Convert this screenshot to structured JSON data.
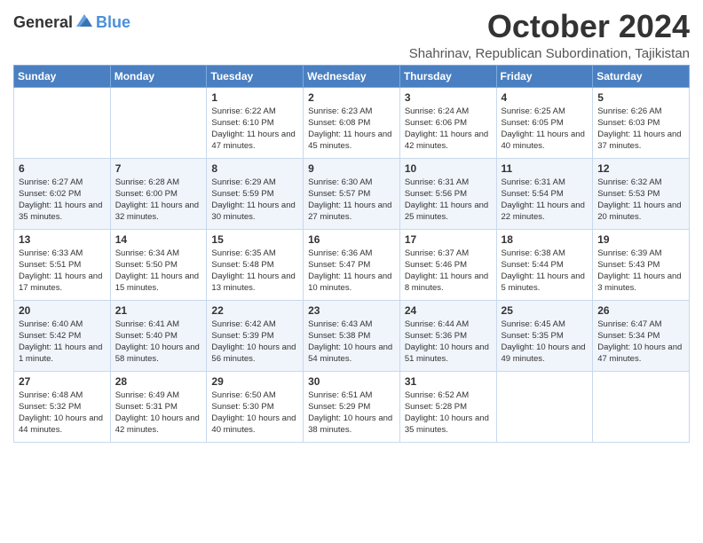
{
  "header": {
    "logo_general": "General",
    "logo_blue": "Blue",
    "month": "October 2024",
    "location": "Shahrinav, Republican Subordination, Tajikistan"
  },
  "days_of_week": [
    "Sunday",
    "Monday",
    "Tuesday",
    "Wednesday",
    "Thursday",
    "Friday",
    "Saturday"
  ],
  "weeks": [
    [
      {
        "day": "",
        "detail": ""
      },
      {
        "day": "",
        "detail": ""
      },
      {
        "day": "1",
        "detail": "Sunrise: 6:22 AM\nSunset: 6:10 PM\nDaylight: 11 hours and 47 minutes."
      },
      {
        "day": "2",
        "detail": "Sunrise: 6:23 AM\nSunset: 6:08 PM\nDaylight: 11 hours and 45 minutes."
      },
      {
        "day": "3",
        "detail": "Sunrise: 6:24 AM\nSunset: 6:06 PM\nDaylight: 11 hours and 42 minutes."
      },
      {
        "day": "4",
        "detail": "Sunrise: 6:25 AM\nSunset: 6:05 PM\nDaylight: 11 hours and 40 minutes."
      },
      {
        "day": "5",
        "detail": "Sunrise: 6:26 AM\nSunset: 6:03 PM\nDaylight: 11 hours and 37 minutes."
      }
    ],
    [
      {
        "day": "6",
        "detail": "Sunrise: 6:27 AM\nSunset: 6:02 PM\nDaylight: 11 hours and 35 minutes."
      },
      {
        "day": "7",
        "detail": "Sunrise: 6:28 AM\nSunset: 6:00 PM\nDaylight: 11 hours and 32 minutes."
      },
      {
        "day": "8",
        "detail": "Sunrise: 6:29 AM\nSunset: 5:59 PM\nDaylight: 11 hours and 30 minutes."
      },
      {
        "day": "9",
        "detail": "Sunrise: 6:30 AM\nSunset: 5:57 PM\nDaylight: 11 hours and 27 minutes."
      },
      {
        "day": "10",
        "detail": "Sunrise: 6:31 AM\nSunset: 5:56 PM\nDaylight: 11 hours and 25 minutes."
      },
      {
        "day": "11",
        "detail": "Sunrise: 6:31 AM\nSunset: 5:54 PM\nDaylight: 11 hours and 22 minutes."
      },
      {
        "day": "12",
        "detail": "Sunrise: 6:32 AM\nSunset: 5:53 PM\nDaylight: 11 hours and 20 minutes."
      }
    ],
    [
      {
        "day": "13",
        "detail": "Sunrise: 6:33 AM\nSunset: 5:51 PM\nDaylight: 11 hours and 17 minutes."
      },
      {
        "day": "14",
        "detail": "Sunrise: 6:34 AM\nSunset: 5:50 PM\nDaylight: 11 hours and 15 minutes."
      },
      {
        "day": "15",
        "detail": "Sunrise: 6:35 AM\nSunset: 5:48 PM\nDaylight: 11 hours and 13 minutes."
      },
      {
        "day": "16",
        "detail": "Sunrise: 6:36 AM\nSunset: 5:47 PM\nDaylight: 11 hours and 10 minutes."
      },
      {
        "day": "17",
        "detail": "Sunrise: 6:37 AM\nSunset: 5:46 PM\nDaylight: 11 hours and 8 minutes."
      },
      {
        "day": "18",
        "detail": "Sunrise: 6:38 AM\nSunset: 5:44 PM\nDaylight: 11 hours and 5 minutes."
      },
      {
        "day": "19",
        "detail": "Sunrise: 6:39 AM\nSunset: 5:43 PM\nDaylight: 11 hours and 3 minutes."
      }
    ],
    [
      {
        "day": "20",
        "detail": "Sunrise: 6:40 AM\nSunset: 5:42 PM\nDaylight: 11 hours and 1 minute."
      },
      {
        "day": "21",
        "detail": "Sunrise: 6:41 AM\nSunset: 5:40 PM\nDaylight: 10 hours and 58 minutes."
      },
      {
        "day": "22",
        "detail": "Sunrise: 6:42 AM\nSunset: 5:39 PM\nDaylight: 10 hours and 56 minutes."
      },
      {
        "day": "23",
        "detail": "Sunrise: 6:43 AM\nSunset: 5:38 PM\nDaylight: 10 hours and 54 minutes."
      },
      {
        "day": "24",
        "detail": "Sunrise: 6:44 AM\nSunset: 5:36 PM\nDaylight: 10 hours and 51 minutes."
      },
      {
        "day": "25",
        "detail": "Sunrise: 6:45 AM\nSunset: 5:35 PM\nDaylight: 10 hours and 49 minutes."
      },
      {
        "day": "26",
        "detail": "Sunrise: 6:47 AM\nSunset: 5:34 PM\nDaylight: 10 hours and 47 minutes."
      }
    ],
    [
      {
        "day": "27",
        "detail": "Sunrise: 6:48 AM\nSunset: 5:32 PM\nDaylight: 10 hours and 44 minutes."
      },
      {
        "day": "28",
        "detail": "Sunrise: 6:49 AM\nSunset: 5:31 PM\nDaylight: 10 hours and 42 minutes."
      },
      {
        "day": "29",
        "detail": "Sunrise: 6:50 AM\nSunset: 5:30 PM\nDaylight: 10 hours and 40 minutes."
      },
      {
        "day": "30",
        "detail": "Sunrise: 6:51 AM\nSunset: 5:29 PM\nDaylight: 10 hours and 38 minutes."
      },
      {
        "day": "31",
        "detail": "Sunrise: 6:52 AM\nSunset: 5:28 PM\nDaylight: 10 hours and 35 minutes."
      },
      {
        "day": "",
        "detail": ""
      },
      {
        "day": "",
        "detail": ""
      }
    ]
  ]
}
